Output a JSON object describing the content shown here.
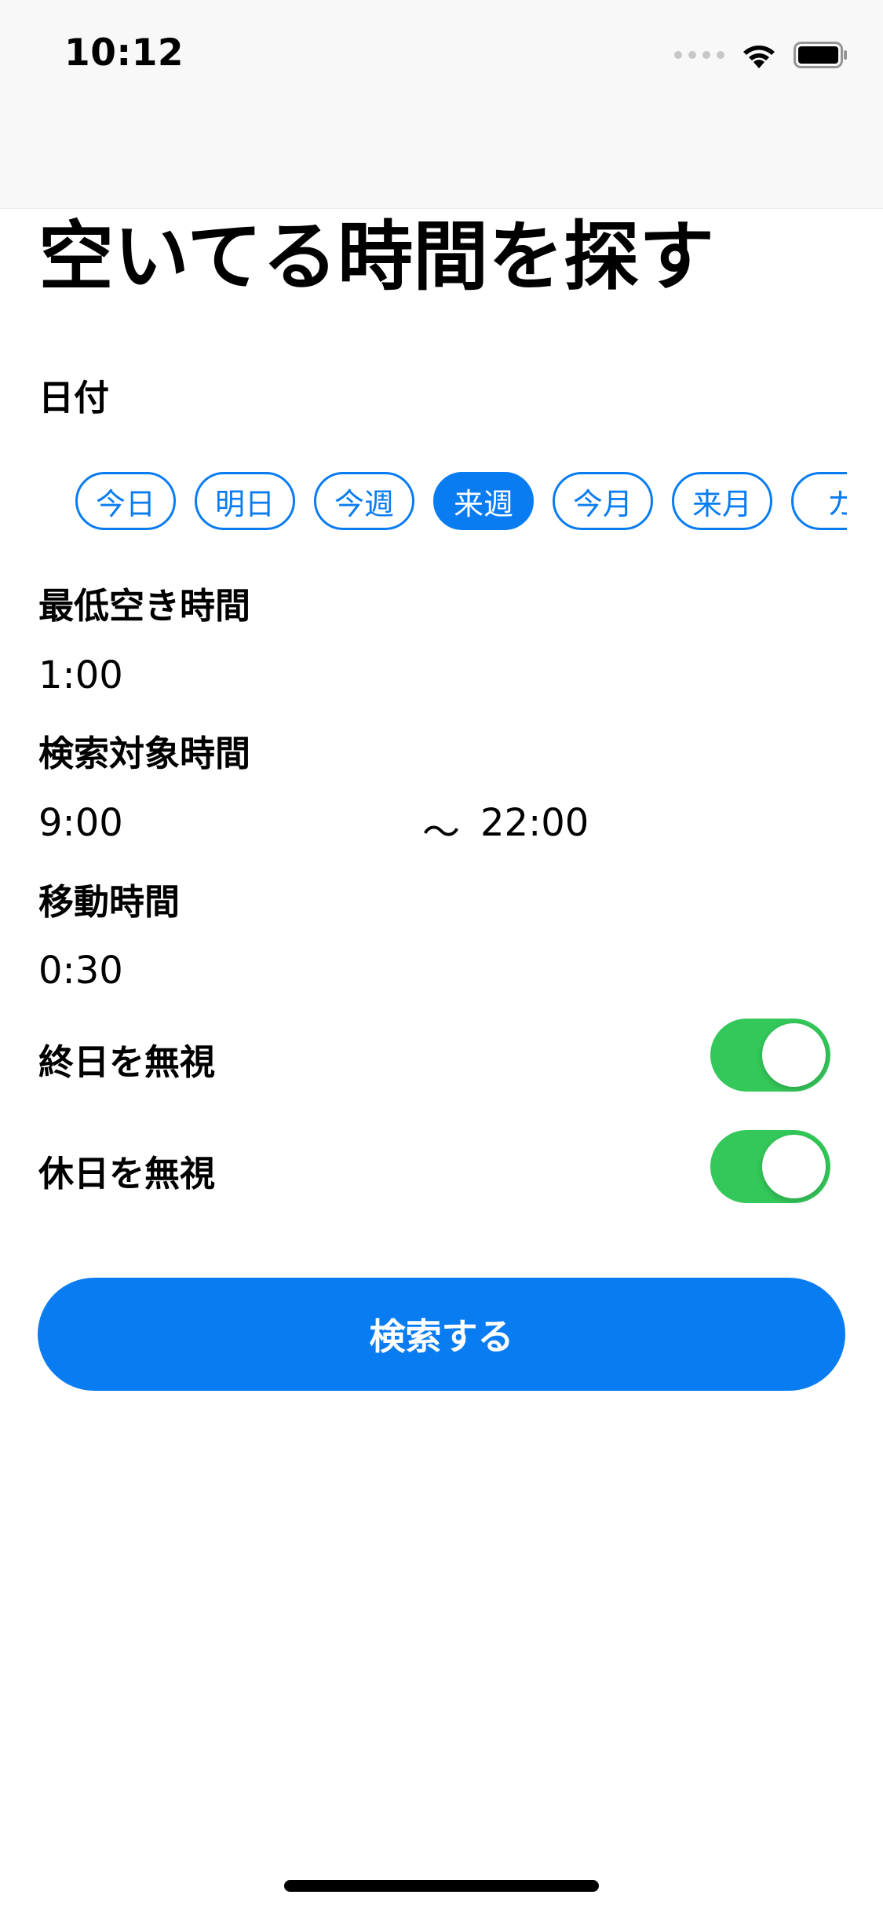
{
  "status_bar": {
    "time": "10:12"
  },
  "title": "空いてる時間を探す",
  "date_section": {
    "label": "日付",
    "chips": [
      {
        "label": "今日",
        "selected": false
      },
      {
        "label": "明日",
        "selected": false
      },
      {
        "label": "今週",
        "selected": false
      },
      {
        "label": "来週",
        "selected": true
      },
      {
        "label": "今月",
        "selected": false
      },
      {
        "label": "来月",
        "selected": false
      },
      {
        "label": "カ",
        "selected": false
      }
    ]
  },
  "min_free_time": {
    "label": "最低空き時間",
    "value": "1:00"
  },
  "search_range": {
    "label": "検索対象時間",
    "start": "9:00",
    "separator": "〜",
    "end": "22:00"
  },
  "travel_time": {
    "label": "移動時間",
    "value": "0:30"
  },
  "toggles": {
    "ignore_all_day": {
      "label": "終日を無視",
      "on": true
    },
    "ignore_holidays": {
      "label": "休日を無視",
      "on": true
    }
  },
  "search_button_label": "検索する",
  "colors": {
    "accent": "#0a7cf2",
    "toggle_on": "#34c759"
  },
  "icons": [
    "signal-icon",
    "wifi-icon",
    "battery-icon"
  ]
}
